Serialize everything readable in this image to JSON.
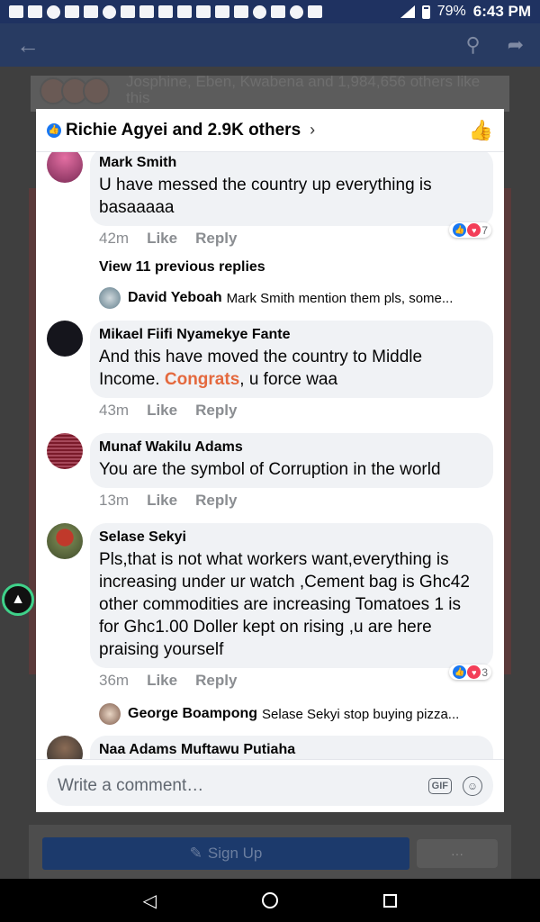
{
  "status_bar": {
    "battery": "79%",
    "time": "6:43 PM"
  },
  "background": {
    "likes_text": "Josphine, Eben, Kwabena and 1,984,656 others like this",
    "signup_label": "Sign Up",
    "more_label": "···"
  },
  "dialog": {
    "title": "Richie Agyei and 2.9K others",
    "comments": [
      {
        "name": "Mark Smith",
        "text": "U have messed the country up everything is basaaaaa",
        "time": "42m",
        "like": "Like",
        "reply": "Reply",
        "reactions": "7"
      },
      {
        "name": "Mikael Fiifi Nyamekye Fante",
        "text_before": "And this have moved the country to Middle Income. ",
        "highlight": "Congrats",
        "text_after": ", u force waa",
        "time": "43m",
        "like": "Like",
        "reply": "Reply"
      },
      {
        "name": "Munaf Wakilu Adams",
        "text": "You are the symbol of Corruption in the world",
        "time": "13m",
        "like": "Like",
        "reply": "Reply"
      },
      {
        "name": "Selase Sekyi",
        "text": "Pls,that is not what workers want,everything is increasing under ur watch ,Cement bag is Ghc42 other commodities are increasing Tomatoes 1 is for Ghc1.00 Doller kept on rising ,u are here praising yourself",
        "time": "36m",
        "like": "Like",
        "reply": "Reply",
        "reactions": "3"
      },
      {
        "name": "Naa Adams Muftawu Putiaha"
      }
    ],
    "view_previous": "View 11 previous replies",
    "replies": [
      {
        "name": "David Yeboah",
        "text": "Mark Smith mention them pls, some..."
      },
      {
        "name": "George Boampong",
        "text": "Selase Sekyi stop buying pizza..."
      }
    ],
    "composer_placeholder": "Write a comment…",
    "gif_label": "GIF"
  }
}
